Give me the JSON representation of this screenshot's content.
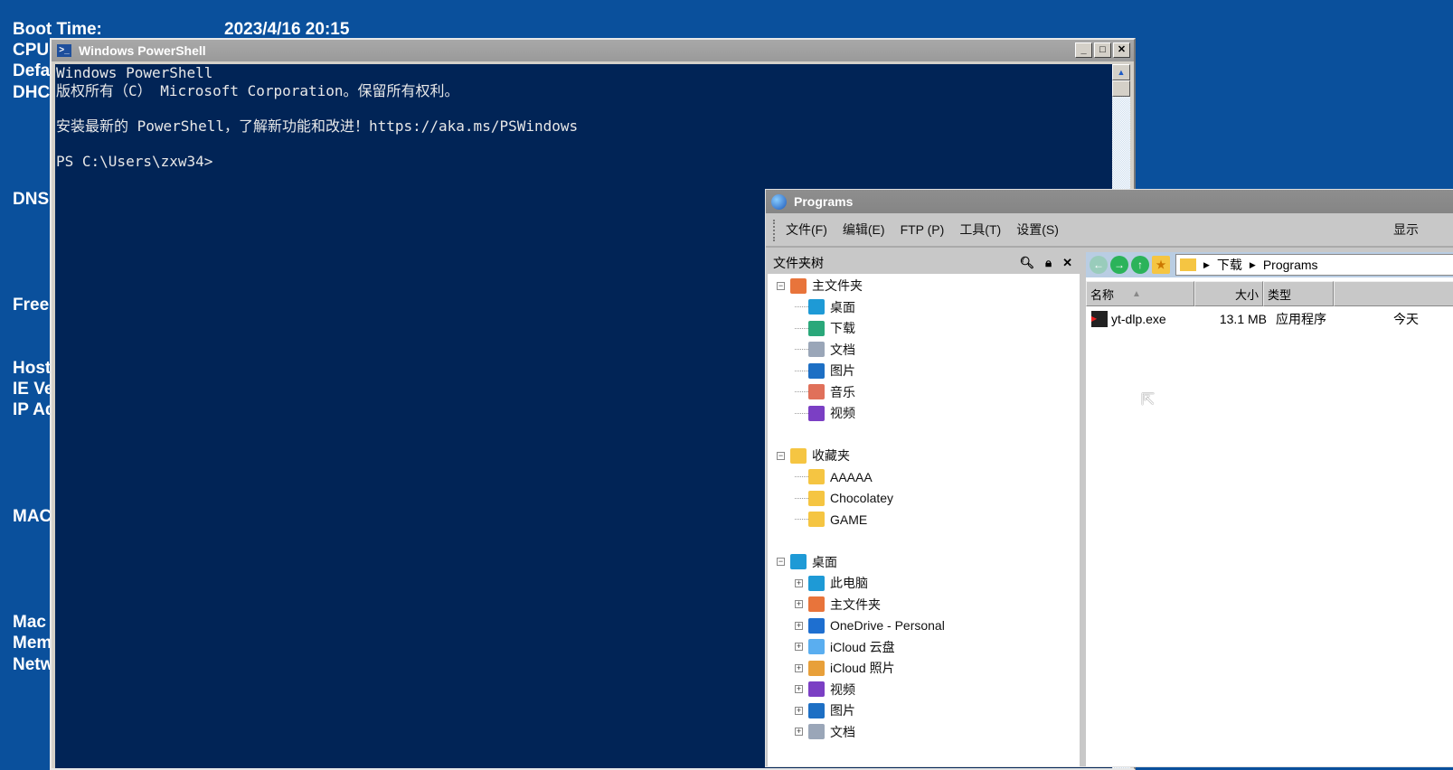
{
  "desktop": {
    "labels": [
      "Boot Time:",
      "CPU",
      "Defa",
      "DHC",
      "DNS",
      "Free",
      "Host",
      "IE Ve",
      "IP Ad",
      "MAC",
      "Mac",
      "Mem",
      "Netw"
    ],
    "boot_time": "2023/4/16 20:15"
  },
  "powershell": {
    "title": "Windows PowerShell",
    "lines": [
      "Windows PowerShell",
      "版权所有（C） Microsoft Corporation。保留所有权利。",
      "",
      "安装最新的 PowerShell，了解新功能和改进！https://aka.ms/PSWindows",
      "",
      "PS C:\\Users\\zxw34>"
    ],
    "buttons": [
      "_",
      "□",
      "✕"
    ]
  },
  "programs": {
    "title": "Programs",
    "menu": [
      "文件(F)",
      "编辑(E)",
      "FTP (P)",
      "工具(T)",
      "设置(S)"
    ],
    "menu_right": "显示",
    "tree_title": "文件夹树",
    "tree": [
      {
        "label": "主文件夹",
        "level": 0,
        "exp": "−",
        "icon": "home-icon",
        "color": "#e8743b"
      },
      {
        "label": "桌面",
        "level": 1,
        "icon": "desktop-icon",
        "color": "#1e9ad6"
      },
      {
        "label": "下载",
        "level": 1,
        "icon": "download-icon",
        "color": "#2aa87a"
      },
      {
        "label": "文档",
        "level": 1,
        "icon": "document-icon",
        "color": "#9aa6b8"
      },
      {
        "label": "图片",
        "level": 1,
        "icon": "pictures-icon",
        "color": "#1d6fc4"
      },
      {
        "label": "音乐",
        "level": 1,
        "icon": "music-icon",
        "color": "#e0705a"
      },
      {
        "label": "视频",
        "level": 1,
        "icon": "video-icon",
        "color": "#7b3fc4"
      },
      {
        "label": "收藏夹",
        "level": 0,
        "exp": "−",
        "icon": "folder-icon",
        "color": "#f5c542",
        "gap": true
      },
      {
        "label": "AAAAA",
        "level": 1,
        "icon": "folder-icon",
        "color": "#f5c542"
      },
      {
        "label": "Chocolatey",
        "level": 1,
        "icon": "folder-icon",
        "color": "#f5c542"
      },
      {
        "label": "GAME",
        "level": 1,
        "icon": "folder-icon",
        "color": "#f5c542"
      },
      {
        "label": "桌面",
        "level": 0,
        "exp": "−",
        "icon": "desktop-icon",
        "color": "#1e9ad6",
        "gap": true
      },
      {
        "label": "此电脑",
        "level": 1,
        "exp": "+",
        "icon": "computer-icon",
        "color": "#1e9ad6"
      },
      {
        "label": "主文件夹",
        "level": 1,
        "exp": "+",
        "icon": "home-icon",
        "color": "#e8743b"
      },
      {
        "label": "OneDrive - Personal",
        "level": 1,
        "exp": "+",
        "icon": "cloud-icon",
        "color": "#1e6fd0"
      },
      {
        "label": "iCloud 云盘",
        "level": 1,
        "exp": "+",
        "icon": "icloud-icon",
        "color": "#5aaef0"
      },
      {
        "label": "iCloud 照片",
        "level": 1,
        "exp": "+",
        "icon": "photos-icon",
        "color": "#e8a03a"
      },
      {
        "label": "视频",
        "level": 1,
        "exp": "+",
        "icon": "video-icon",
        "color": "#7b3fc4"
      },
      {
        "label": "图片",
        "level": 1,
        "exp": "+",
        "icon": "pictures-icon",
        "color": "#1d6fc4"
      },
      {
        "label": "文档",
        "level": 1,
        "exp": "+",
        "icon": "document-icon",
        "color": "#9aa6b8"
      }
    ],
    "path": [
      "下载",
      "Programs"
    ],
    "columns": [
      "名称",
      "大小",
      "类型"
    ],
    "files": [
      {
        "name": "yt-dlp.exe",
        "size": "13.1 MB",
        "type": "应用程序",
        "date": "今天"
      }
    ]
  }
}
